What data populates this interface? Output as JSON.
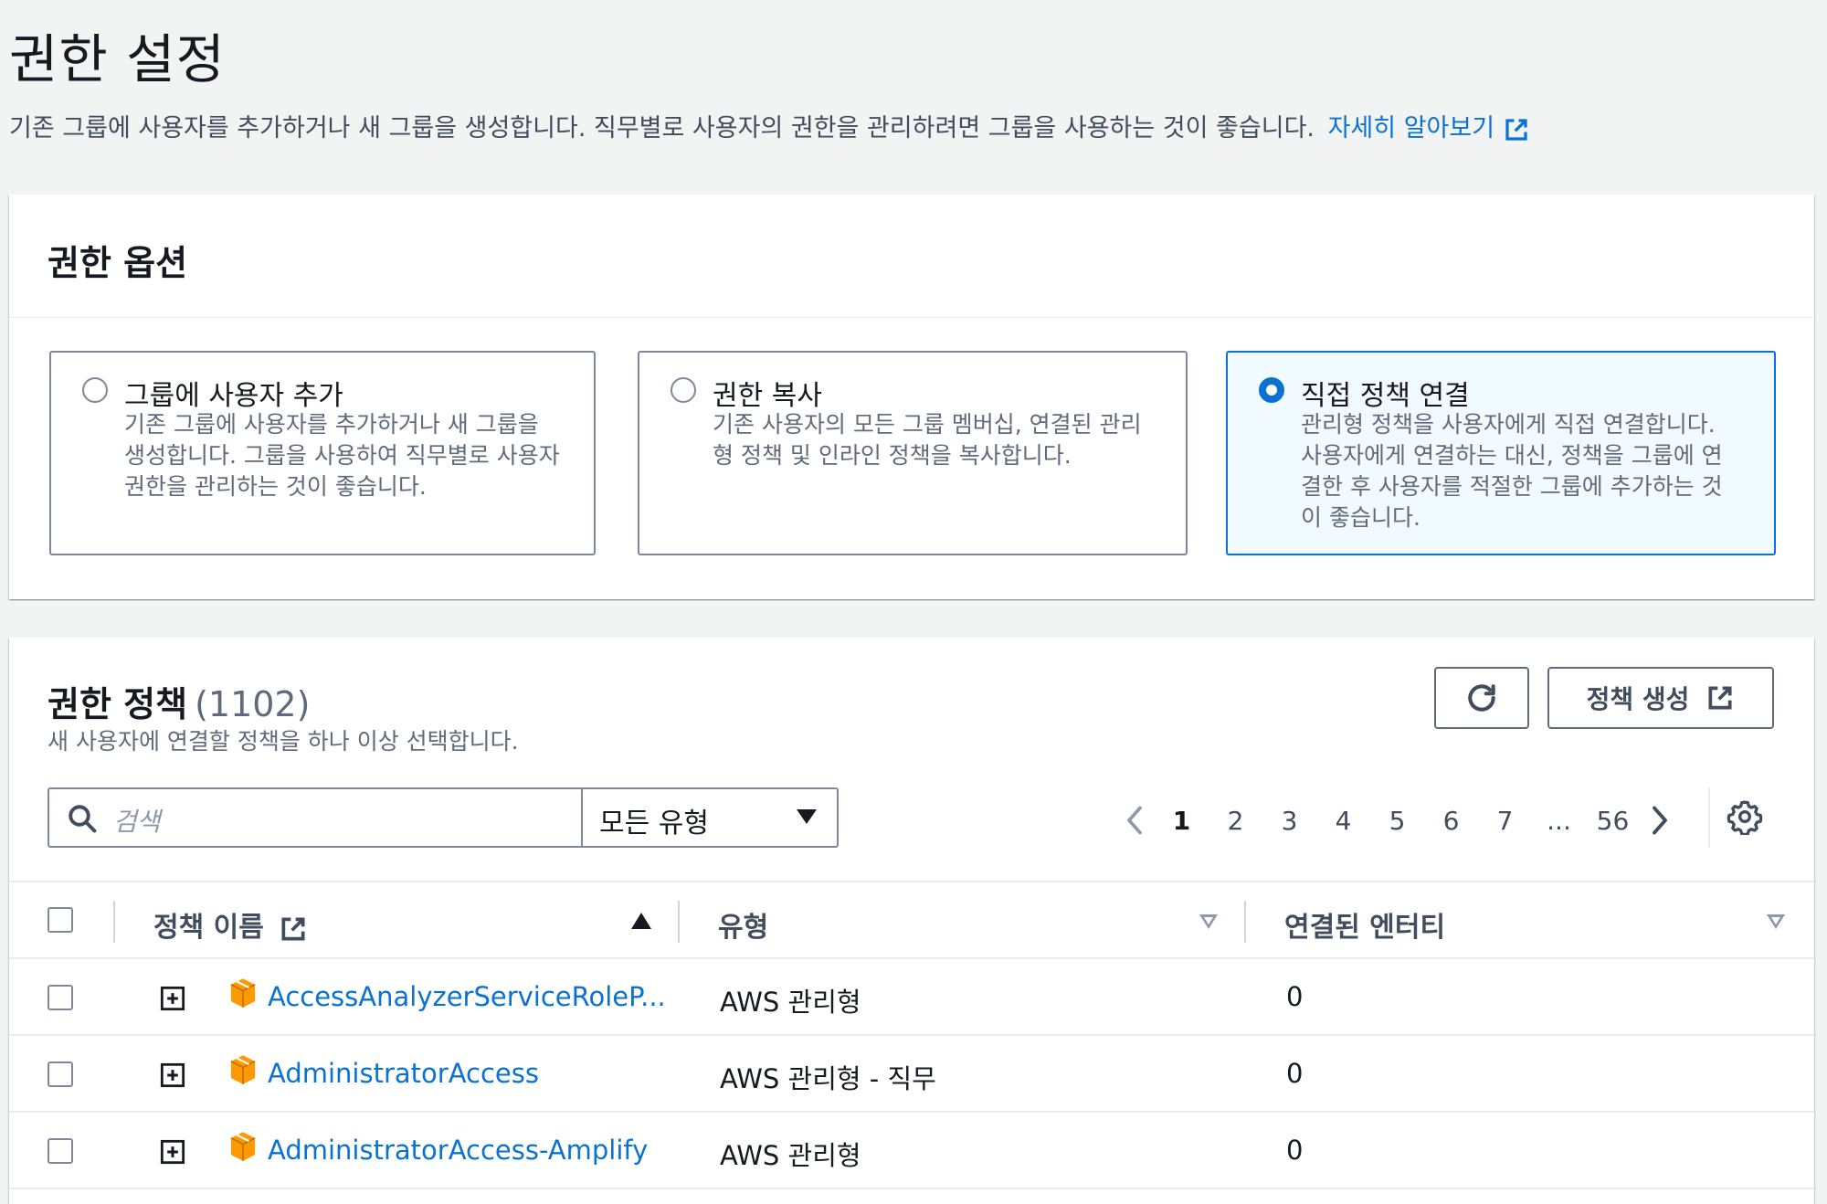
{
  "header": {
    "title": "권한 설정",
    "description": "기존 그룹에 사용자를 추가하거나 새 그룹을 생성합니다. 직무별로 사용자의 권한을 관리하려면 그룹을 사용하는 것이 좋습니다.",
    "learn_more": "자세히 알아보기"
  },
  "options": {
    "title": "권한 옵션",
    "items": [
      {
        "title": "그룹에 사용자 추가",
        "desc": "기존 그룹에 사용자를 추가하거나 새 그룹을 생성합니다. 그룹을 사용하여 직무별로 사용자 권한을 관리하는 것이 좋습니다.",
        "selected": false
      },
      {
        "title": "권한 복사",
        "desc": "기존 사용자의 모든 그룹 멤버십, 연결된 관리형 정책 및 인라인 정책을 복사합니다.",
        "selected": false
      },
      {
        "title": "직접 정책 연결",
        "desc": "관리형 정책을 사용자에게 직접 연결합니다. 사용자에게 연결하는 대신, 정책을 그룹에 연결한 후 사용자를 적절한 그룹에 추가하는 것이 좋습니다.",
        "selected": true
      }
    ]
  },
  "policies": {
    "title": "권한 정책",
    "count": "(1102)",
    "subtitle": "새 사용자에 연결할 정책을 하나 이상 선택합니다.",
    "create_label": "정책 생성",
    "search_placeholder": "검색",
    "type_filter": "모든 유형",
    "pages": [
      "1",
      "2",
      "3",
      "4",
      "5",
      "6",
      "7",
      "...",
      "56"
    ],
    "current_page": "1",
    "columns": {
      "name": "정책 이름",
      "type": "유형",
      "entities": "연결된 엔터티"
    },
    "rows": [
      {
        "name": "AccessAnalyzerServiceRoleP...",
        "type": "AWS 관리형",
        "entities": "0"
      },
      {
        "name": "AdministratorAccess",
        "type": "AWS 관리형 - 직무",
        "entities": "0"
      },
      {
        "name": "AdministratorAccess-Amplify",
        "type": "AWS 관리형",
        "entities": "0"
      }
    ]
  },
  "colors": {
    "link": "#0972d3",
    "selected_bg": "#f1faff",
    "aws_orange": "#ff9900"
  },
  "icons": [
    "external-link-icon",
    "refresh-icon",
    "search-icon",
    "chevron-left-icon",
    "chevron-right-icon",
    "settings-icon",
    "expand-icon",
    "aws-package-icon"
  ]
}
